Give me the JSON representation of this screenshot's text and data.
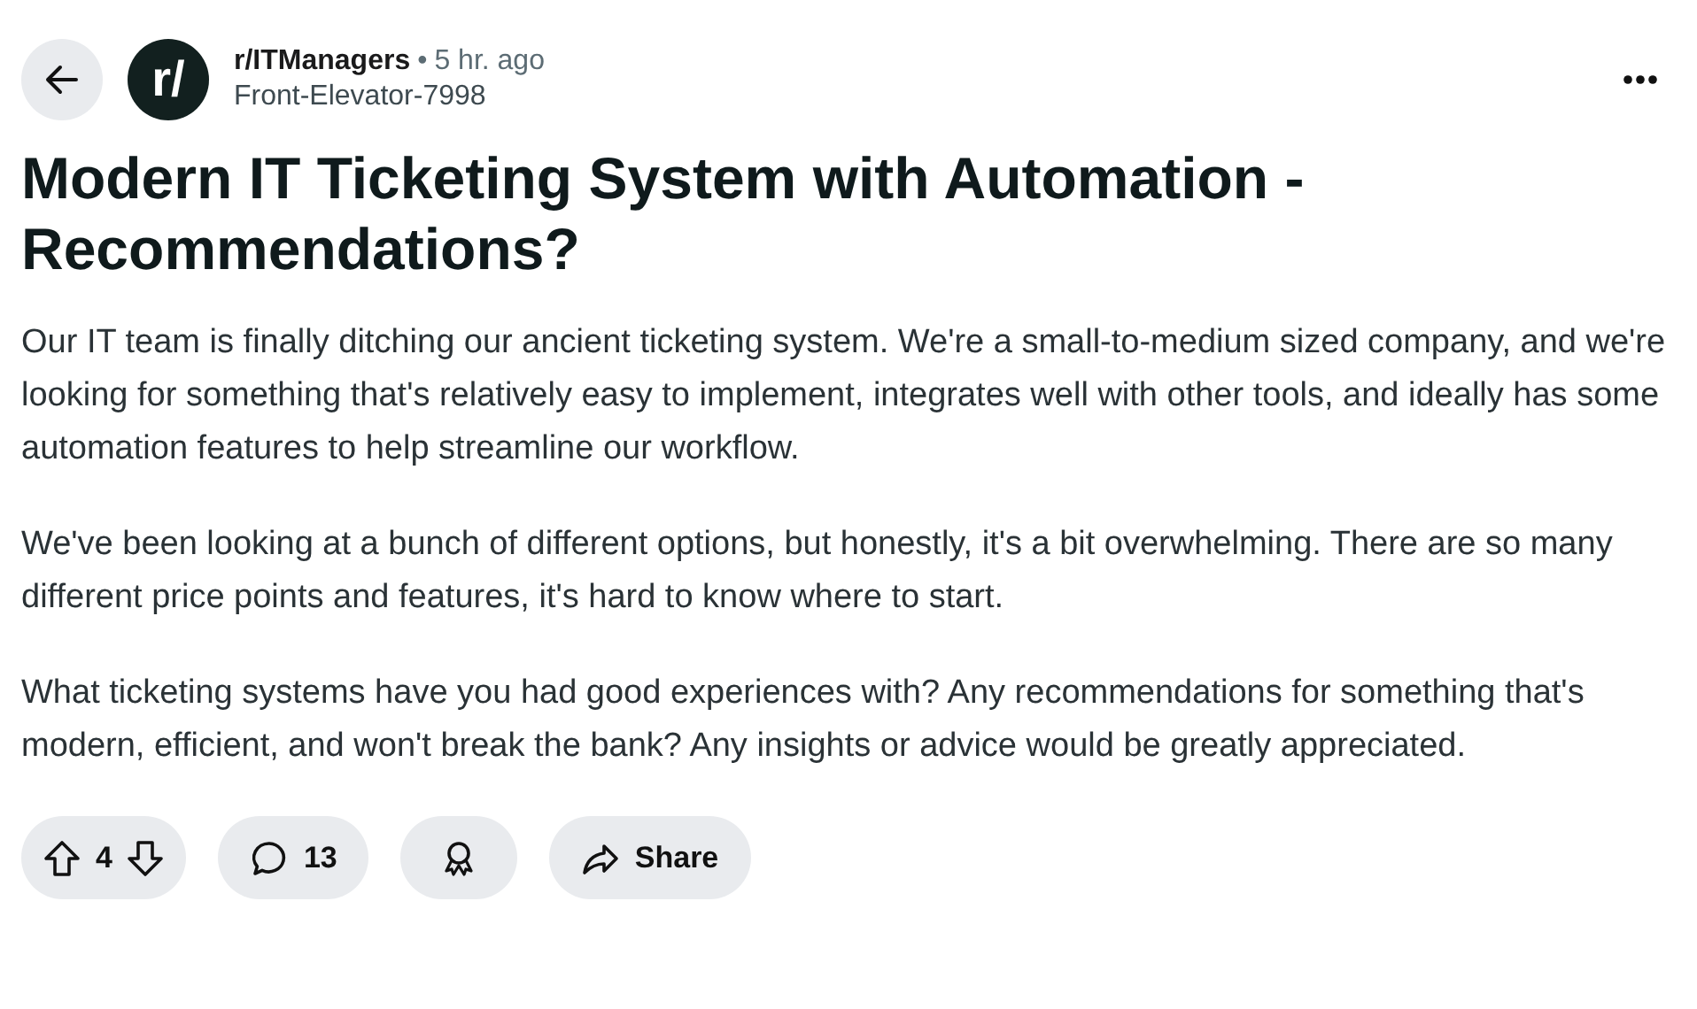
{
  "post": {
    "subreddit": "r/ITManagers",
    "separator": "•",
    "time": "5 hr. ago",
    "author": "Front-Elevator-7998",
    "avatar_text": "r/",
    "title": "Modern IT Ticketing System with Automation - Recommendations?",
    "paragraphs": [
      "Our IT team is finally ditching our ancient ticketing system. We're a small-to-medium sized company, and we're looking for something that's relatively easy to implement, integrates well with other tools, and ideally has some automation features to help streamline our workflow.",
      "We've been looking at a bunch of different options, but honestly, it's a bit overwhelming. There are so many different price points and features, it's hard to know where to start.",
      "What ticketing systems have you had good experiences with? Any recommendations for something that's modern, efficient, and won't break the bank? Any insights or advice would be greatly appreciated."
    ]
  },
  "actions": {
    "votes": "4",
    "comments": "13",
    "share": "Share"
  }
}
